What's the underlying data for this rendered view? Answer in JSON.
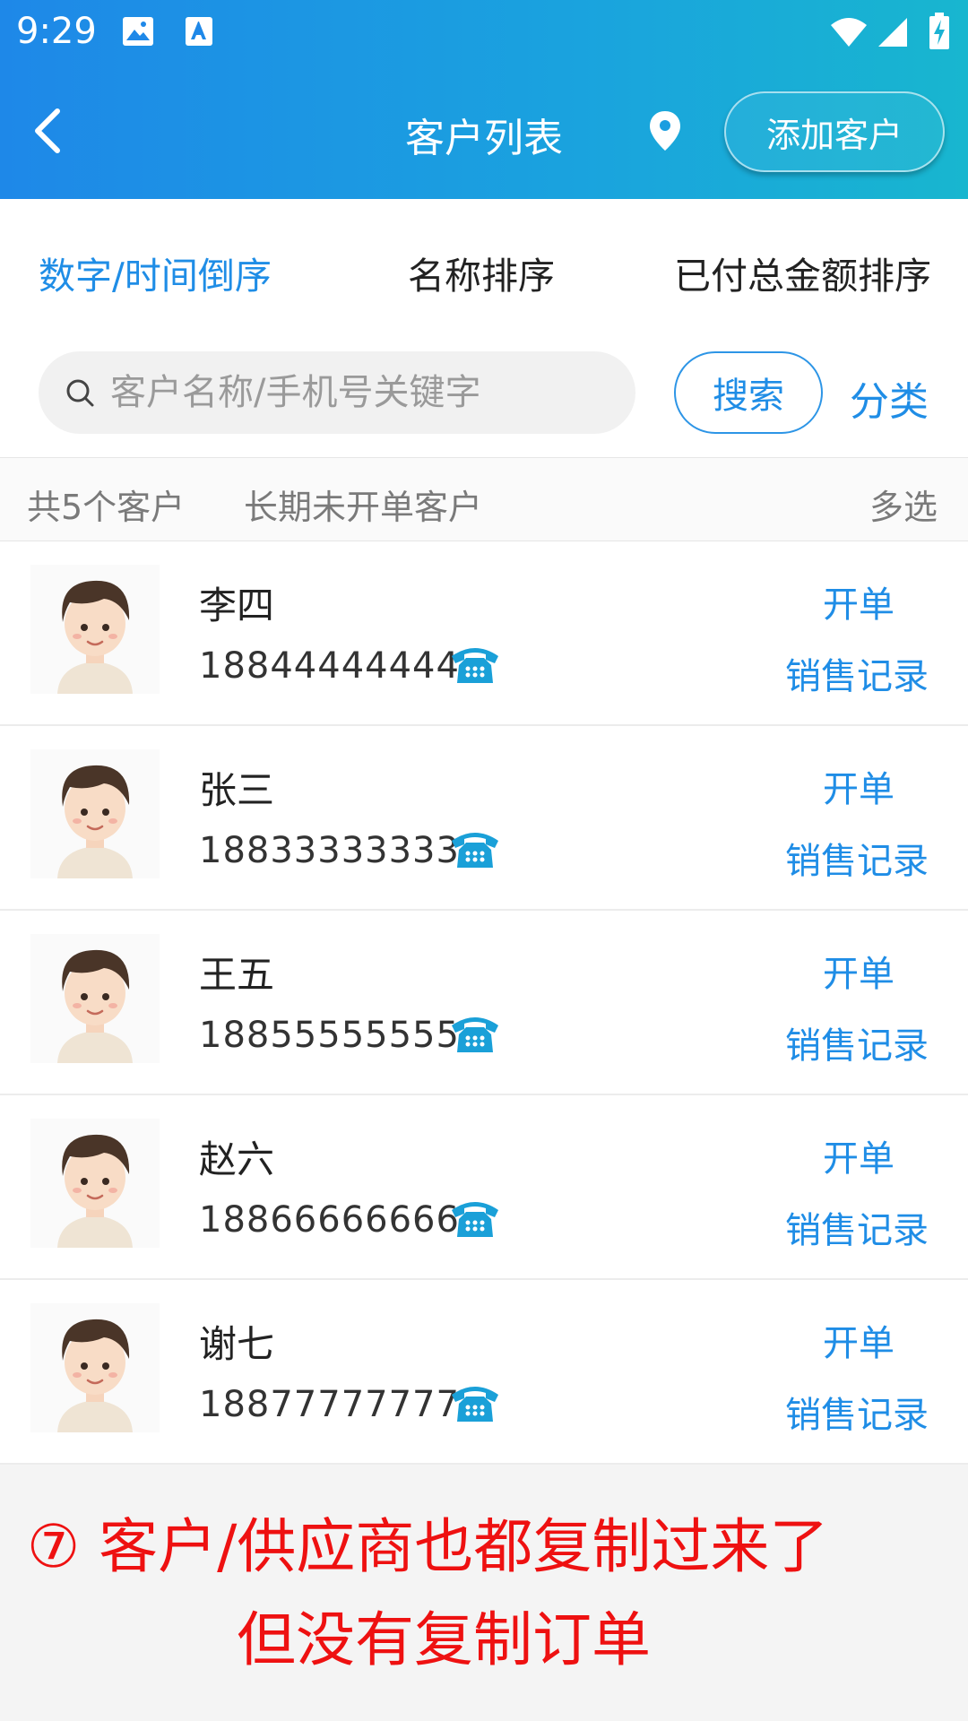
{
  "status_bar": {
    "time": "9:29"
  },
  "header": {
    "title": "客户列表",
    "add_button": "添加客户"
  },
  "sort_tabs": [
    {
      "label": "数字/时间倒序",
      "active": true
    },
    {
      "label": "名称排序",
      "active": false
    },
    {
      "label": "已付总金额排序",
      "active": false
    }
  ],
  "search": {
    "placeholder": "客户名称/手机号关键字",
    "button": "搜索",
    "category": "分类"
  },
  "summary": {
    "count_text": "共5个客户",
    "inactive_filter": "长期未开单客户",
    "multi_select": "多选"
  },
  "customers": [
    {
      "name": "李四",
      "phone": "18844444444",
      "order": "开单",
      "sales": "销售记录"
    },
    {
      "name": "张三",
      "phone": "18833333333",
      "order": "开单",
      "sales": "销售记录"
    },
    {
      "name": "王五",
      "phone": "18855555555",
      "order": "开单",
      "sales": "销售记录"
    },
    {
      "name": "赵六",
      "phone": "18866666666",
      "order": "开单",
      "sales": "销售记录"
    },
    {
      "name": "谢七",
      "phone": "18877777777",
      "order": "开单",
      "sales": "销售记录"
    }
  ],
  "annotation": {
    "line1": "⑦ 客户/供应商也都复制过来了",
    "line2": "但没有复制订单"
  },
  "colors": {
    "accent": "#1f8de6",
    "header_start": "#1e88e8",
    "header_end": "#18b6cf",
    "phone_icon": "#1aa0d8",
    "annotation": "#ee1111"
  }
}
